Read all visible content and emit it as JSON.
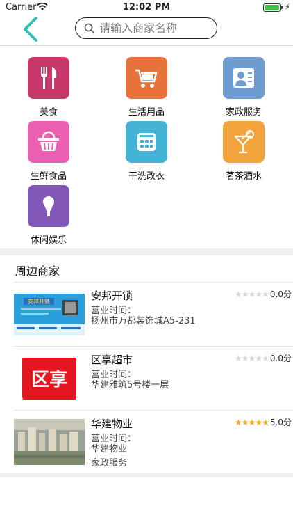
{
  "status_bar": {
    "carrier": "Carrier",
    "time": "12:02 PM"
  },
  "nav": {
    "back_icon": "chevron-left-icon",
    "search_placeholder": "请输入商家名称"
  },
  "categories": [
    {
      "label": "美食",
      "color": "#c9386a",
      "icon": "utensils-icon"
    },
    {
      "label": "生活用品",
      "color": "#e8733a",
      "icon": "shopping-cart-icon"
    },
    {
      "label": "家政服务",
      "color": "#6f9cd0",
      "icon": "contact-card-icon"
    },
    {
      "label": "生鲜食品",
      "color": "#ea5fb0",
      "icon": "basket-icon"
    },
    {
      "label": "干洗改衣",
      "color": "#45b3d6",
      "icon": "washing-machine-icon"
    },
    {
      "label": "茗茶酒水",
      "color": "#f4a43c",
      "icon": "cocktail-icon"
    },
    {
      "label": "休闲娱乐",
      "color": "#8157b8",
      "icon": "microphone-icon"
    }
  ],
  "section_title": "周边商家",
  "stores": [
    {
      "name": "安邦开锁",
      "hours_label": "营业时间：",
      "address": "扬州市万都装饰城A5-231",
      "extra": "",
      "rating": 0,
      "score": "0.0分",
      "thumb": "business-card-thumbnail"
    },
    {
      "name": "区享超市",
      "hours_label": "营业时间：",
      "address": "华建雅筑5号楼一层",
      "extra": "",
      "rating": 0,
      "score": "0.0分",
      "thumb": "logo-thumbnail",
      "logo_text": "区享"
    },
    {
      "name": "华建物业",
      "hours_label": "营业时间：",
      "address": "华建物业",
      "extra": "家政服务",
      "rating": 5,
      "score": "5.0分",
      "thumb": "building-photo-thumbnail"
    }
  ],
  "thumb_card": {
    "title": "安邦开锁"
  },
  "colors": {
    "accent": "#2cbfae",
    "star_on": "#f5a623",
    "star_off": "#d6d6d6"
  }
}
